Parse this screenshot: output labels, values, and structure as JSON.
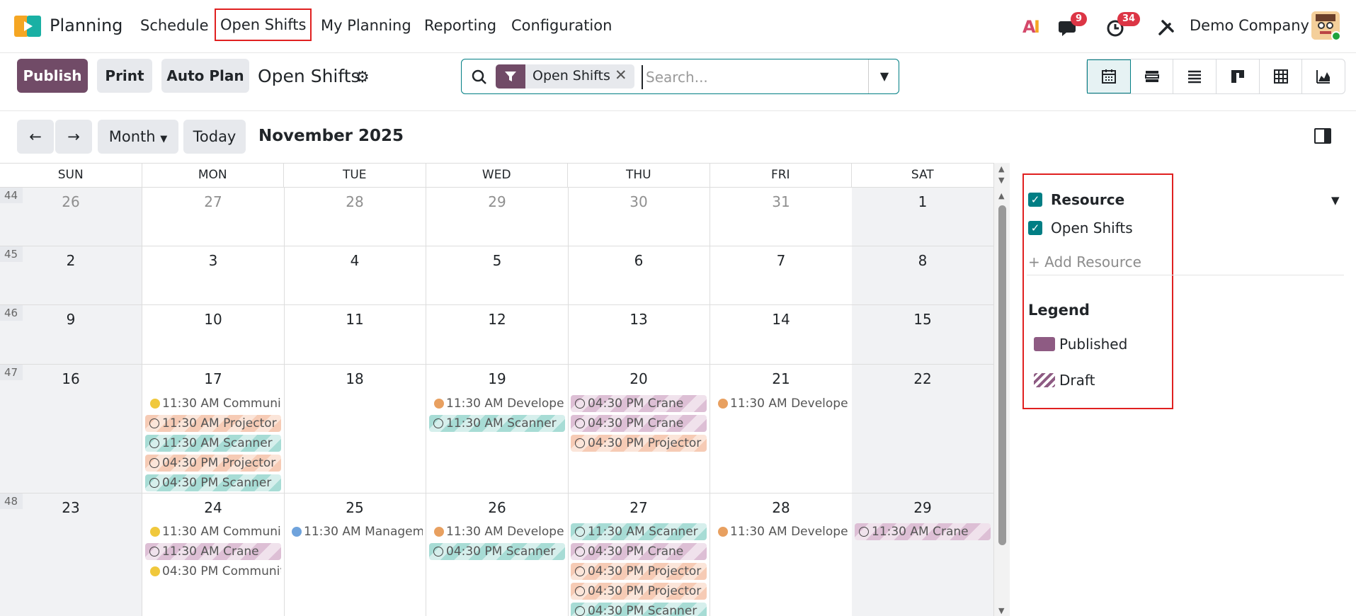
{
  "app": {
    "name": "Planning"
  },
  "menu": [
    "Schedule",
    "Open Shifts",
    "My Planning",
    "Reporting",
    "Configuration"
  ],
  "top_right": {
    "chat_badge": "9",
    "activity_badge": "34",
    "company": "Demo Company"
  },
  "toolbar": {
    "publish": "Publish",
    "print": "Print",
    "auto_plan": "Auto Plan",
    "title": "Open Shifts"
  },
  "search": {
    "facet": "Open Shifts",
    "placeholder": "Search..."
  },
  "calendar_nav": {
    "scale": "Month",
    "today": "Today",
    "period": "November 2025"
  },
  "weekdays": [
    "SUN",
    "MON",
    "TUE",
    "WED",
    "THU",
    "FRI",
    "SAT"
  ],
  "weeks": [
    {
      "num": "44",
      "days": [
        "26",
        "27",
        "28",
        "29",
        "30",
        "31",
        "1"
      ]
    },
    {
      "num": "45",
      "days": [
        "2",
        "3",
        "4",
        "5",
        "6",
        "7",
        "8"
      ]
    },
    {
      "num": "46",
      "days": [
        "9",
        "10",
        "11",
        "12",
        "13",
        "14",
        "15"
      ]
    },
    {
      "num": "47",
      "days": [
        "16",
        "17",
        "18",
        "19",
        "20",
        "21",
        "22"
      ]
    },
    {
      "num": "48",
      "days": [
        "23",
        "24",
        "25",
        "26",
        "27",
        "28",
        "29"
      ]
    }
  ],
  "events": {
    "w47": {
      "mon": [
        "11:30 AM Communi",
        "11:30 AM Projector",
        "11:30 AM Scanner",
        "04:30 PM Projector",
        "04:30 PM Scanner"
      ],
      "wed": [
        "11:30 AM Developer",
        "11:30 AM Scanner"
      ],
      "thu": [
        "04:30 PM Crane",
        "04:30 PM Crane",
        "04:30 PM Projector"
      ],
      "fri": [
        "11:30 AM Developer"
      ]
    },
    "w48": {
      "mon": [
        "11:30 AM Communi",
        "11:30 AM Crane",
        "04:30 PM Communit"
      ],
      "tue": [
        "11:30 AM Managem"
      ],
      "wed": [
        "11:30 AM Developer",
        "04:30 PM Scanner"
      ],
      "thu": [
        "11:30 AM Scanner",
        "04:30 PM Crane",
        "04:30 PM Projector",
        "04:30 PM Projector",
        "04:30 PM Scanner"
      ],
      "fri": [
        "11:30 AM Developer"
      ],
      "sat": [
        "11:30 AM Crane"
      ]
    }
  },
  "sidebar": {
    "resource_label": "Resource",
    "resource_item": "Open Shifts",
    "add_resource": "+ Add Resource",
    "legend_title": "Legend",
    "legend_published": "Published",
    "legend_draft": "Draft"
  },
  "colors": {
    "brand": "#714b67",
    "accent": "#017e84",
    "highlight": "#e02020"
  }
}
